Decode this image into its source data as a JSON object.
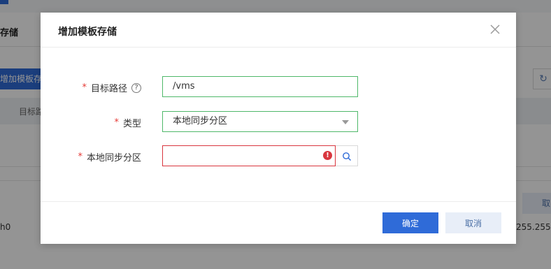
{
  "background": {
    "page_title": "存储",
    "add_button_label": "增加模板存储",
    "table_first_column": "目标路",
    "row_left_text": "h0",
    "row_right_text": "255.255.255",
    "right_button_label": "取"
  },
  "dialog": {
    "title": "增加模板存储",
    "fields": {
      "target_path": {
        "label": "目标路径",
        "required_mark": "*",
        "help": "?",
        "value": "/vms"
      },
      "type": {
        "label": "类型",
        "required_mark": "*",
        "selected": "本地同步分区"
      },
      "local_sync_partition": {
        "label": "本地同步分区",
        "required_mark": "*",
        "value": "",
        "error_mark": "!"
      }
    },
    "buttons": {
      "ok": "确定",
      "cancel": "取消"
    }
  },
  "colors": {
    "primary": "#2f6bd8",
    "valid_border": "#4fb86a",
    "error": "#d9363e",
    "secondary_bg": "#e8eef8"
  }
}
